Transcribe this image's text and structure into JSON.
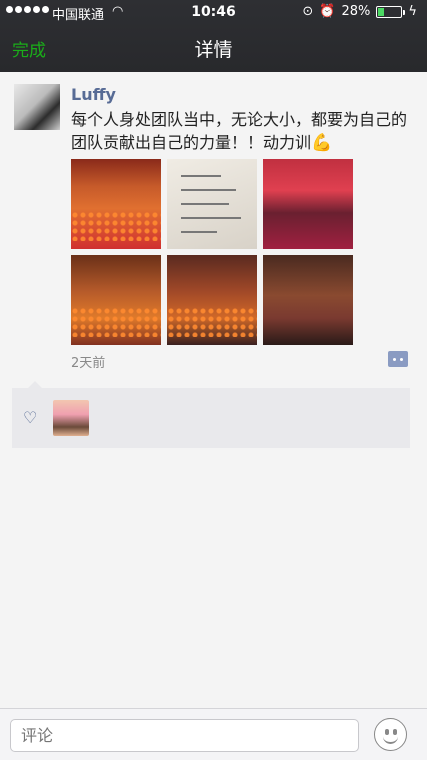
{
  "status_bar": {
    "carrier": "中国联通",
    "time": "10:46",
    "battery_percent": "28%",
    "battery_level": 0.28
  },
  "nav": {
    "done_label": "完成",
    "title": "详情"
  },
  "post": {
    "username": "Luffy",
    "content": "每个人身处团队当中，无论大小，都要为自己的团队贡献出自己的力量！！动力训",
    "emoji": "flexed-biceps",
    "photos": [
      "photo-1",
      "photo-2",
      "photo-3",
      "photo-4",
      "photo-5",
      "photo-6"
    ],
    "time": "2天前"
  },
  "bottom_bar": {
    "comment_placeholder": "评论"
  },
  "colors": {
    "accent_green": "#1aad19",
    "name_blue": "#576b95"
  }
}
